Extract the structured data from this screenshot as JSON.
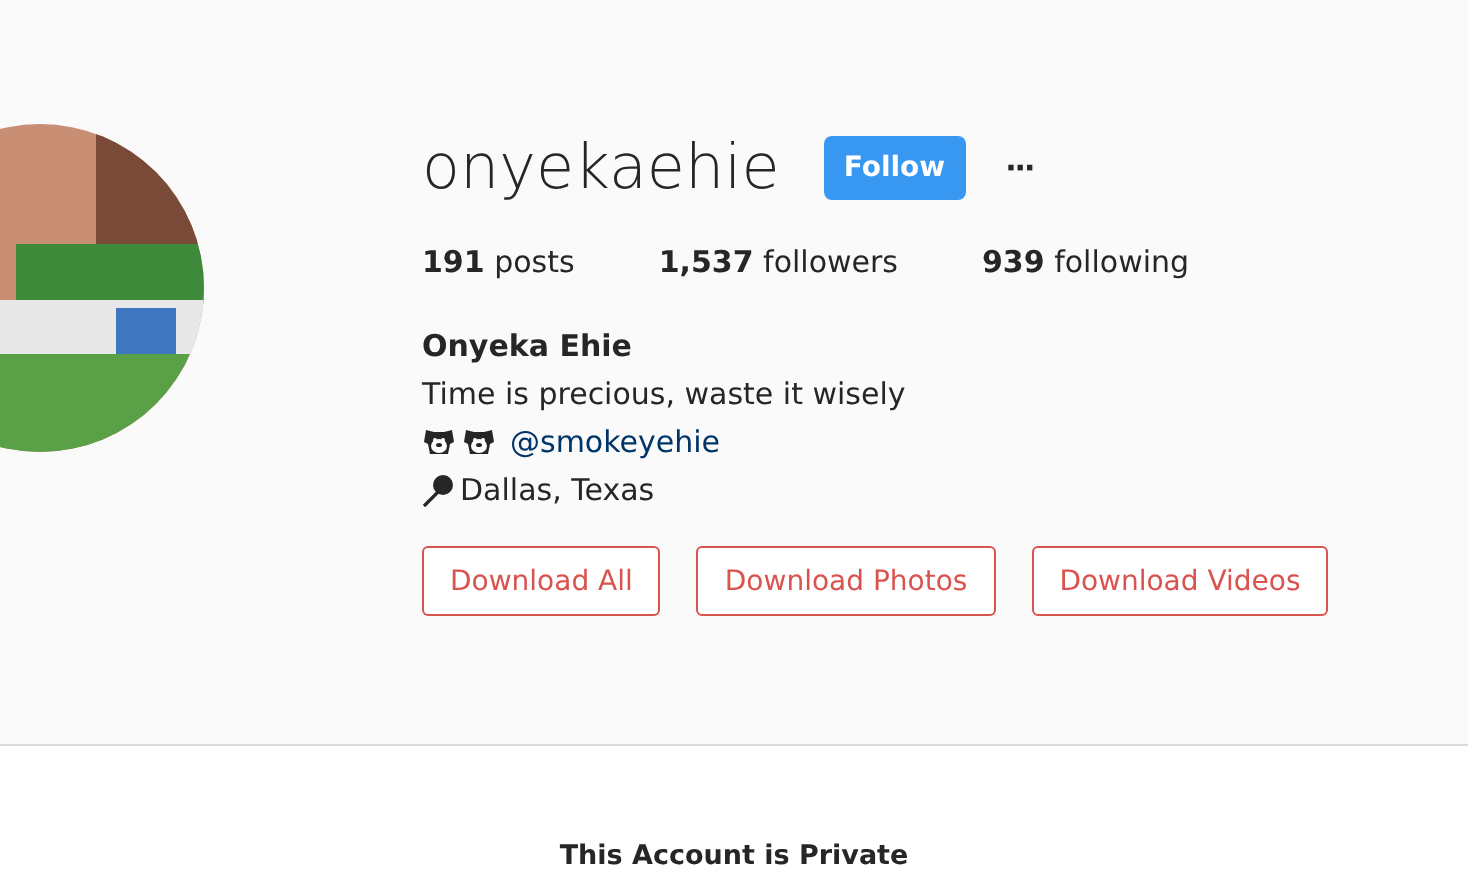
{
  "profile": {
    "username": "onyekaehie",
    "follow_button": "Follow",
    "more_button": "···",
    "stats": [
      {
        "count": "191",
        "label": "posts"
      },
      {
        "count": "1,537",
        "label": "followers"
      },
      {
        "count": "939",
        "label": "following"
      }
    ],
    "full_name": "Onyeka Ehie",
    "bio": "Time is precious, waste it wisely",
    "mention": "@smokeyehie",
    "location": "Dallas, Texas",
    "download_buttons": [
      "Download All",
      "Download Photos",
      "Download Videos"
    ]
  },
  "private_notice": "This Account is Private"
}
